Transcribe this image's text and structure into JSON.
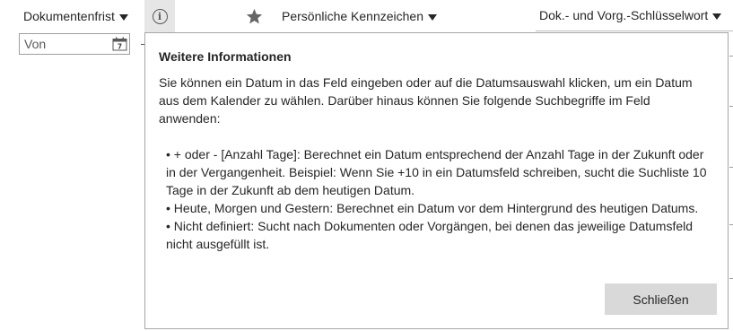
{
  "header": {
    "dokumentenfrist_label": "Dokumentenfrist",
    "info_icon": "info-icon",
    "favorite_icon": "star-icon",
    "kennzeichen_label": "Persönliche Kennzeichen",
    "schluesselwort_label": "Dok.- und Vorg.-Schlüsselwort"
  },
  "date_filter": {
    "placeholder": "Von",
    "value": "",
    "calendar_icon": "calendar-icon",
    "calendar_day": "7"
  },
  "popup": {
    "title": "Weitere Informationen",
    "intro": "Sie können ein Datum in das Feld eingeben oder auf die Datumsauswahl klicken, um ein Datum aus dem Kalender zu wählen. Darüber hinaus können Sie folgende Suchbegriffe im Feld anwenden:",
    "bullets": [
      "• + oder - [Anzahl Tage]: Berechnet ein Datum entsprechend der Anzahl Tage in der Zukunft oder in der Vergangenheit. Beispiel: Wenn Sie +10 in ein Datumsfeld schreiben, sucht die Suchliste 10 Tage in der Zukunft ab dem heutigen Datum.",
      "• Heute, Morgen und Gestern: Berechnet ein Datum vor dem Hintergrund des heutigen Datums.",
      "• Nicht definiert: Sucht nach Dokumenten oder Vorgängen, bei denen das jeweilige Datumsfeld nicht ausgefüllt ist."
    ],
    "close_label": "Schließen"
  }
}
